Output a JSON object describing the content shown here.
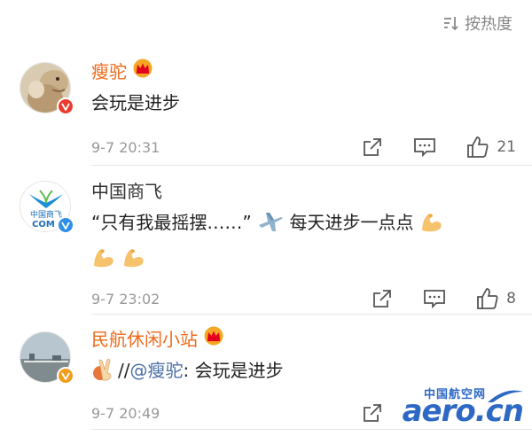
{
  "sort": {
    "label": "按热度"
  },
  "comments": [
    {
      "name": "瘦驼",
      "text": "会玩是进步",
      "time": "9-7 20:31",
      "likes": "21"
    },
    {
      "name": "中国商飞",
      "avatar_text_top": "中国商飞",
      "avatar_text_bottom": "COM",
      "text_line1": "“只有我最摇摆……”",
      "text_line1_after": " 每天进步一点点",
      "time": "9-7 23:02",
      "likes": "8"
    },
    {
      "name": "民航休闲小站",
      "mention_prefix": "//",
      "mention": "@瘦驼",
      "text_after": ": 会玩是进步",
      "time": "9-7 20:49"
    }
  ],
  "watermark": {
    "title": "中国航空网",
    "logo": "aero.cn"
  },
  "colors": {
    "vip_name": "#ef6a1a",
    "mention": "#4a6fa5",
    "crown": "#f5a623",
    "verify_orange": "#f29d1b",
    "verify_blue": "#2f8fe6",
    "watermark": "#2d68c4"
  },
  "icons": [
    "sort-icon",
    "crown-icon",
    "verified-icon",
    "share-icon",
    "comment-icon",
    "like-icon",
    "flexed-biceps-emoji",
    "airplane-emoji",
    "victory-hand-emoji"
  ]
}
